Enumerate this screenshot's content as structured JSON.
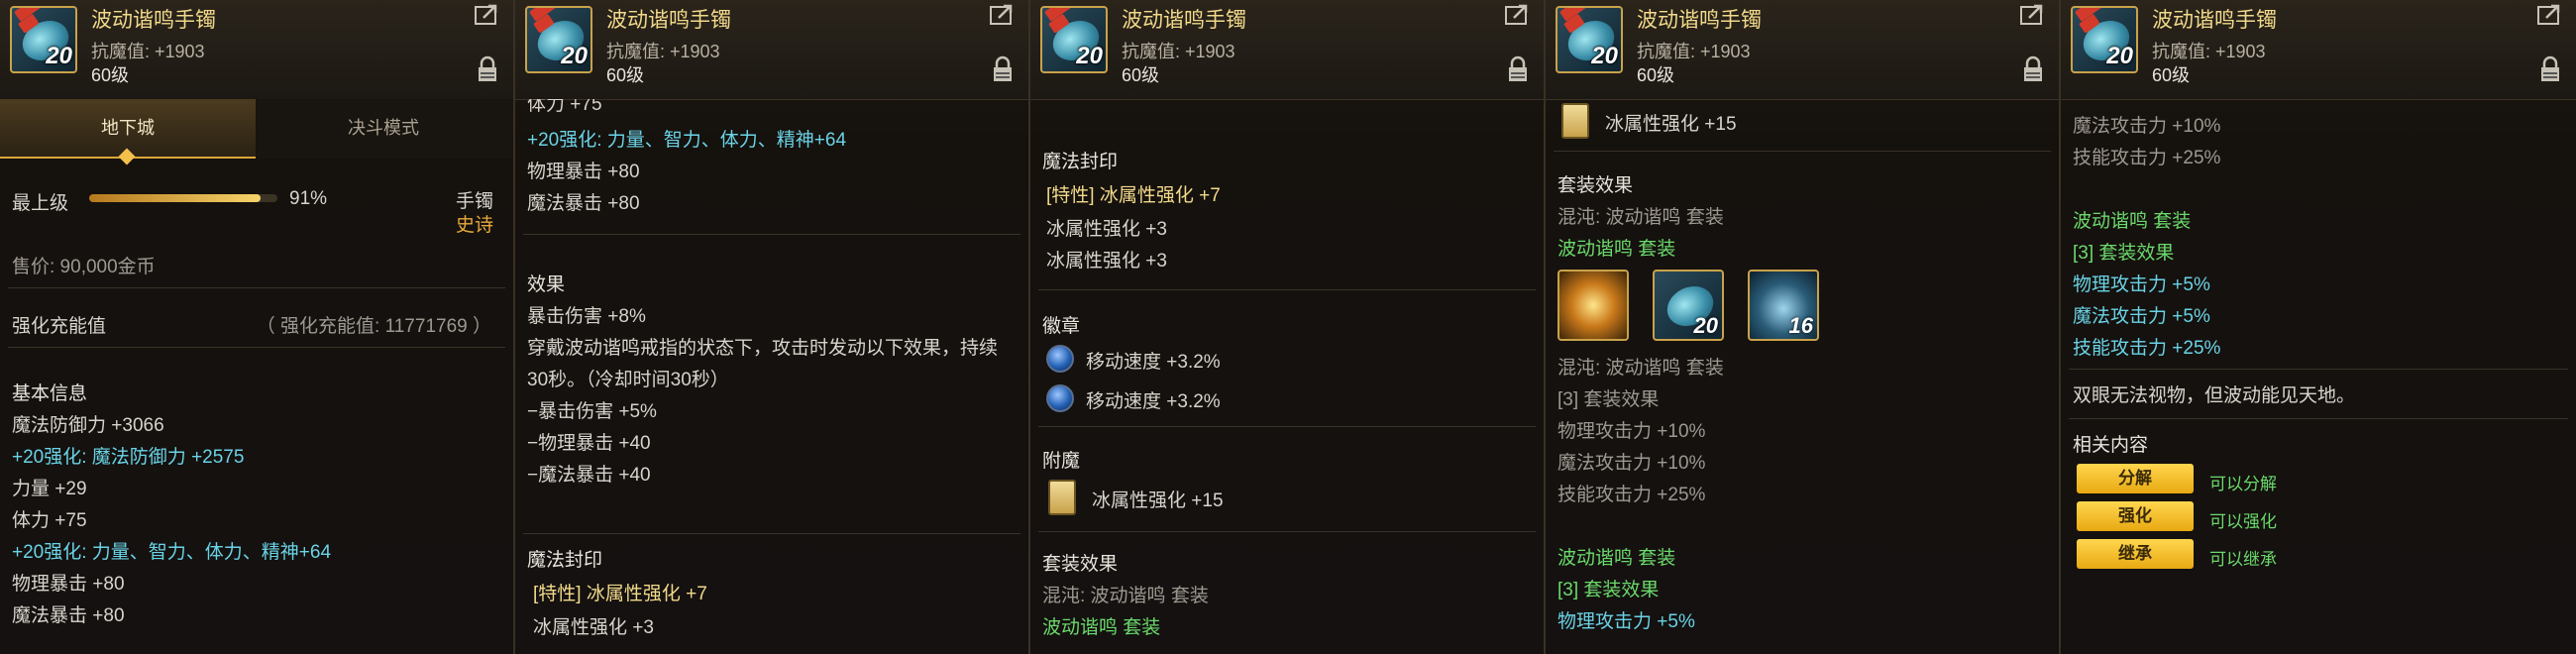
{
  "item": {
    "name": "波动谐鸣手镯",
    "magic_resist": "抗魔值: +1903",
    "level": "60级",
    "icon_level": "20"
  },
  "panel1": {
    "tabs": [
      "地下城",
      "决斗模式"
    ],
    "grade_label": "最上级",
    "grade_percent": "91%",
    "grade_fill": 0.91,
    "slot": "手镯",
    "rarity": "史诗",
    "price": "售价: 90,000金币",
    "charge_label": "强化充能值",
    "charge_value": "（ 强化充能值: 11771769 ）",
    "basic_title": "基本信息",
    "lines": [
      "魔法防御力 +3066",
      "+20强化:  魔法防御力 +2575",
      "力量 +29",
      "体力 +75",
      "+20强化:  力量、智力、体力、精神+64",
      "物理暴击 +80",
      "魔法暴击 +80"
    ]
  },
  "panel2": {
    "partial_top": "体力 +75",
    "lines_top": [
      "+20强化:  力量、智力、体力、精神+64",
      "物理暴击 +80",
      "魔法暴击 +80"
    ],
    "effect_title": "效果",
    "effect_lines": [
      "暴击伤害 +8%",
      "穿戴波动谐鸣戒指的状态下，攻击时发动以下效果，持续",
      "30秒。（冷却时间30秒）",
      "−暴击伤害 +5%",
      "−物理暴击 +40",
      "−魔法暴击 +40"
    ],
    "seal_title": "魔法封印",
    "seal_lines": [
      "[特性] 冰属性强化 +7",
      "冰属性强化 +3"
    ]
  },
  "panel3": {
    "seal_title": "魔法封印",
    "seal_lines": [
      "[特性] 冰属性强化 +7",
      "冰属性强化 +3",
      "冰属性强化 +3"
    ],
    "emblem_title": "徽章",
    "emblems": [
      "移动速度 +3.2%",
      "移动速度 +3.2%"
    ],
    "enchant_title": "附魔",
    "enchant": "冰属性强化 +15",
    "set_title": "套装效果",
    "set_sub": "混沌:  波动谐鸣  套装",
    "set_name": "波动谐鸣  套装"
  },
  "panel4": {
    "enchant": "冰属性强化 +15",
    "set_title": "套装效果",
    "set_sub": "混沌:  波动谐鸣  套装",
    "set_name": "波动谐鸣  套装",
    "set_icons": [
      "",
      "20",
      "16"
    ],
    "set_sub2": "混沌:  波动谐鸣  套装",
    "bonus_title": "[3] 套装效果",
    "bonus_lines": [
      "物理攻击力 +10%",
      "魔法攻击力 +10%",
      "技能攻击力 +25%"
    ],
    "set_name2": "波动谐鸣  套装",
    "bonus_title2": "[3] 套装效果",
    "bonus_line2": "物理攻击力 +5%"
  },
  "panel5": {
    "gray_lines": [
      "魔法攻击力 +10%",
      "技能攻击力 +25%"
    ],
    "set_name": "波动谐鸣  套装",
    "bonus_title": "[3] 套装效果",
    "bonus_lines": [
      "物理攻击力 +5%",
      "魔法攻击力 +5%",
      "技能攻击力 +25%"
    ],
    "flavor": "双眼无法视物，但波动能见天地。",
    "related_title": "相关内容",
    "actions": [
      {
        "label": "分解",
        "note": "可以分解"
      },
      {
        "label": "强化",
        "note": "可以强化"
      },
      {
        "label": "继承",
        "note": "可以继承"
      }
    ]
  }
}
